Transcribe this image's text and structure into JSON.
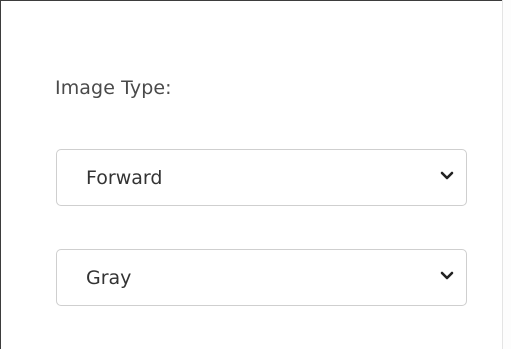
{
  "image_type": {
    "label": "Image Type:",
    "direction_select": {
      "value": "Forward",
      "icon": "chevron-down-icon"
    },
    "color_select": {
      "value": "Gray",
      "icon": "chevron-down-icon"
    }
  }
}
